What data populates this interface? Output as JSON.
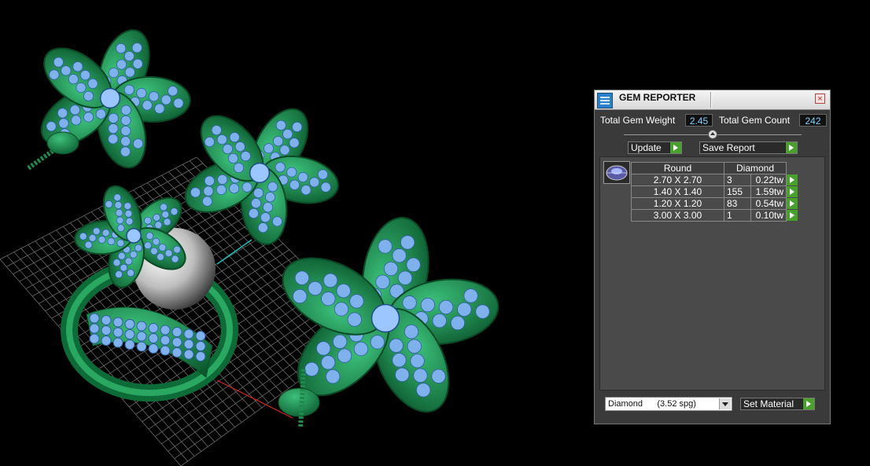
{
  "panel": {
    "title": "GEM REPORTER",
    "close_symbol": "×",
    "total_weight_label": "Total Gem Weight",
    "total_weight_value": "2.45",
    "total_count_label": "Total Gem Count",
    "total_count_value": "242",
    "update_label": "Update",
    "save_report_label": "Save Report",
    "table": {
      "shape_header": "Round",
      "material_header": "Diamond",
      "rows": [
        {
          "size": "2.70 X 2.70",
          "count": "3",
          "weight": "0.22tw"
        },
        {
          "size": "1.40 X 1.40",
          "count": "155",
          "weight": "1.59tw"
        },
        {
          "size": "1.20 X 1.20",
          "count": "83",
          "weight": "0.54tw"
        },
        {
          "size": "3.00 X 3.00",
          "count": "1",
          "weight": "0.10tw"
        }
      ]
    },
    "material_select_value": "Diamond      (3.52 spg)",
    "set_material_label": "Set Material"
  },
  "colors": {
    "metal": "#1f8a4c",
    "gem": "#7fb2ec",
    "pearl": "#e8e8e8",
    "grid": "#6a6a6a",
    "value_text": "#7fd3ff",
    "play_button": "#4aa02c"
  }
}
